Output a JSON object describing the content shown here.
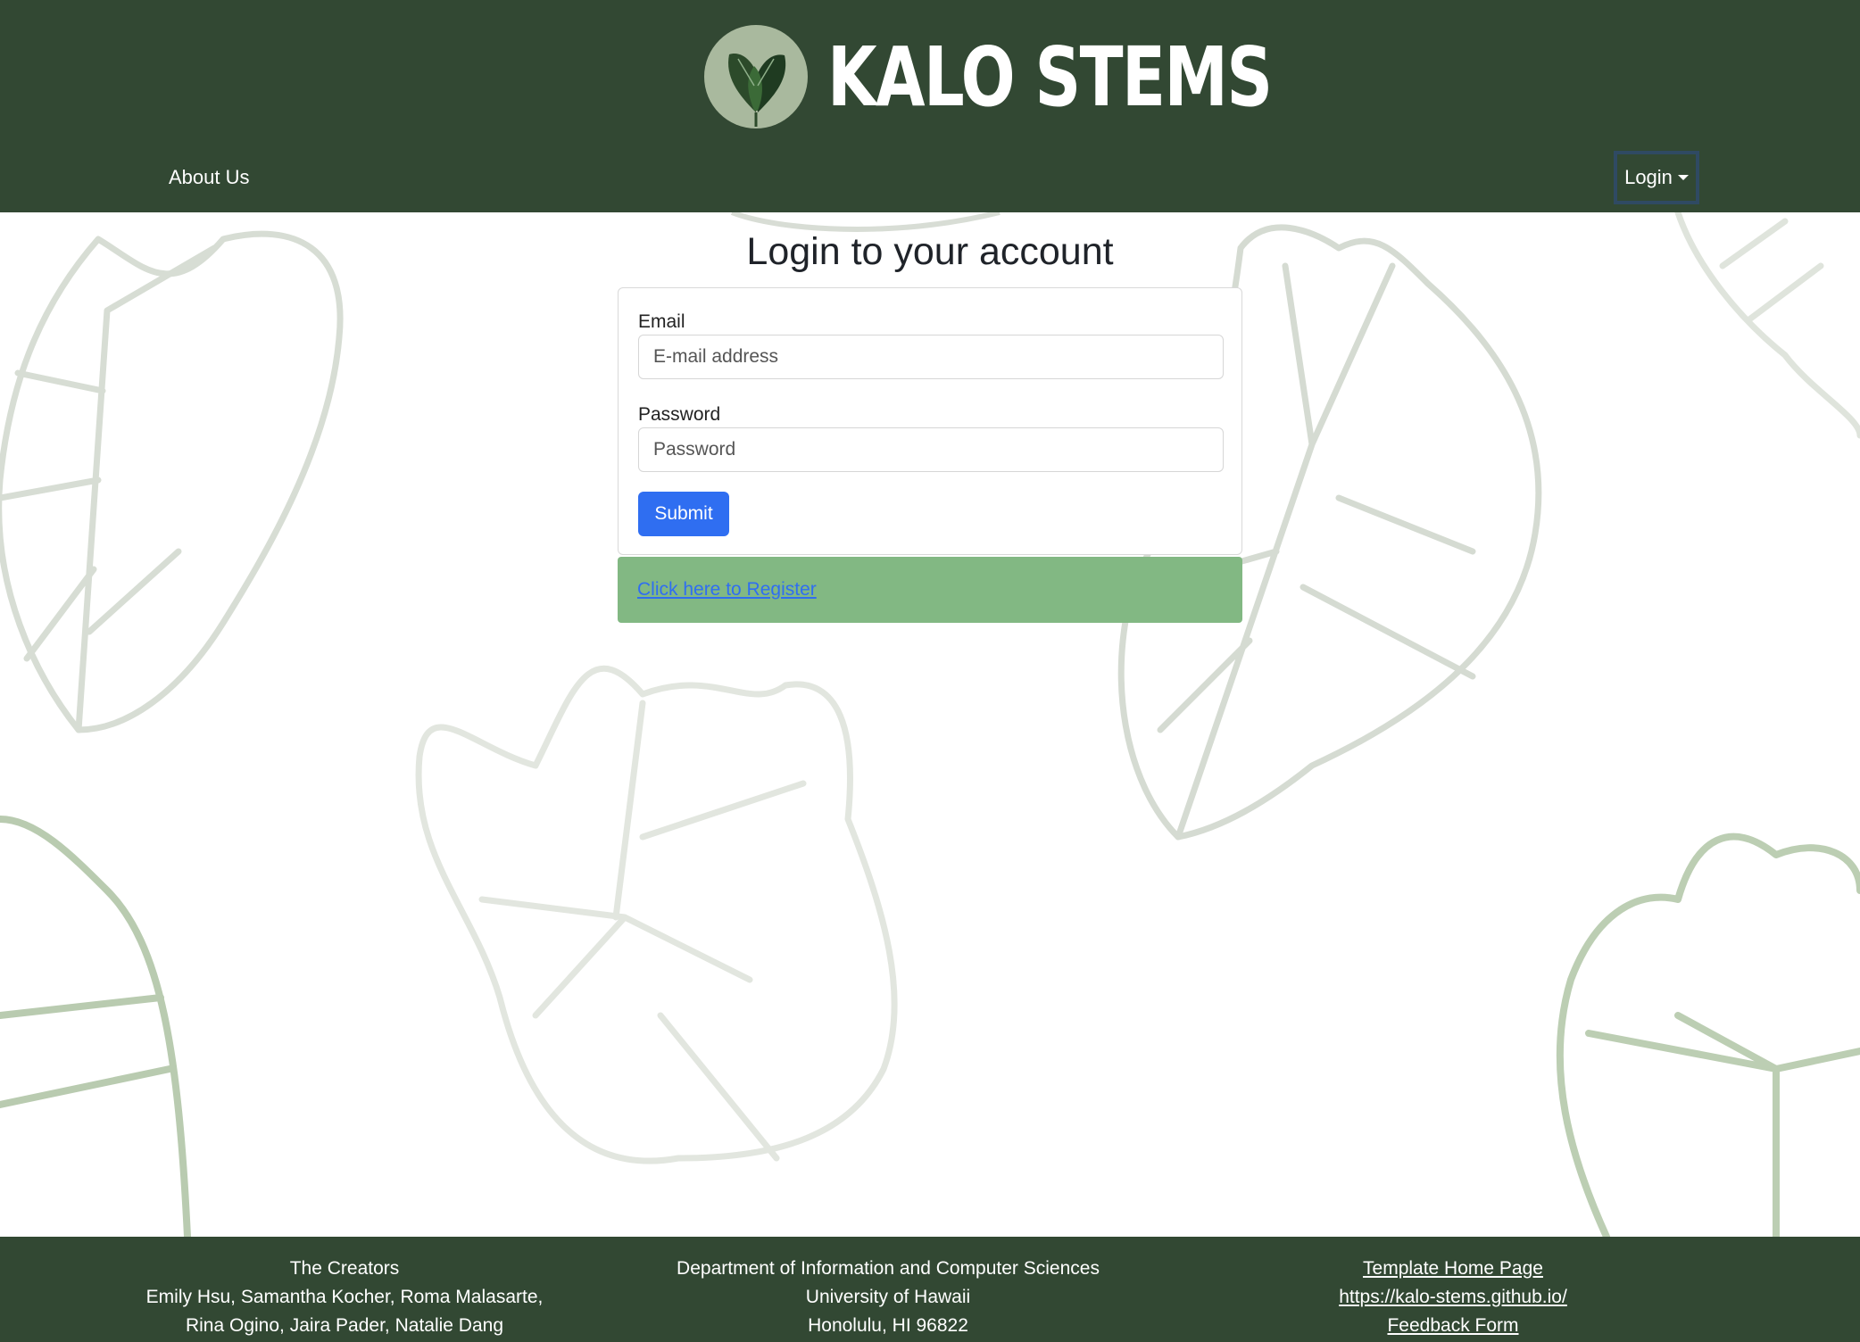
{
  "header": {
    "brand_title": "KALO STEMS",
    "nav": {
      "about_label": "About Us",
      "login_label": "Login"
    }
  },
  "main": {
    "title": "Login to your account",
    "form": {
      "email_label": "Email",
      "email_placeholder": "E-mail address",
      "password_label": "Password",
      "password_placeholder": "Password",
      "submit_label": "Submit"
    },
    "register_link": "Click here to Register"
  },
  "footer": {
    "creators": {
      "title": "The Creators",
      "line1": "Emily Hsu, Samantha Kocher, Roma Malasarte,",
      "line2": "Rina Ogino, Jaira Pader, Natalie Dang"
    },
    "department": {
      "line1": "Department of Information and Computer Sciences",
      "line2": "University of Hawaii",
      "line3": "Honolulu, HI 96822"
    },
    "links": {
      "template": "Template Home Page",
      "site": "https://kalo-stems.github.io/",
      "feedback": "Feedback Form"
    }
  },
  "colors": {
    "header_bg": "#324833",
    "submit_bg": "#2f6ef1",
    "register_bg": "#82b883"
  },
  "icons": {
    "logo": "taro-leaf-logo-icon",
    "login_caret": "caret-down-icon"
  }
}
